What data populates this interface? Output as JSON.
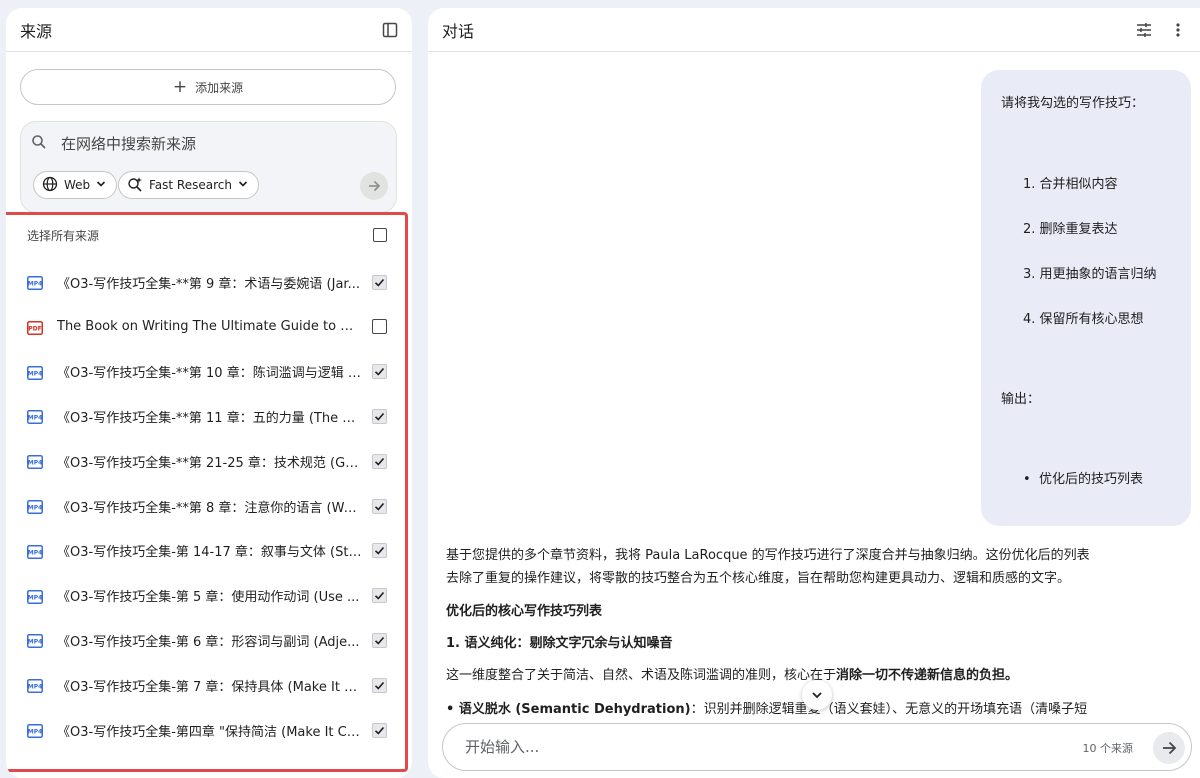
{
  "sources_panel": {
    "title": "来源",
    "add_source_label": "添加来源",
    "search_placeholder": "在网络中搜索新来源",
    "web_chip": "Web",
    "research_chip": "Fast Research",
    "select_all_label": "选择所有来源",
    "select_all_checked": false,
    "items": [
      {
        "type": "mp4",
        "label": "《O3-写作技巧全集-**第 9 章：术语与委婉语 (Jar...",
        "checked": true
      },
      {
        "type": "pdf",
        "label": "The Book on Writing The Ultimate Guide to Writin...",
        "checked": false
      },
      {
        "type": "mp4",
        "label": "《O3-写作技巧全集-**第 10 章：陈词滥调与逻辑 (...",
        "checked": true
      },
      {
        "type": "mp4",
        "label": "《O3-写作技巧全集-**第 11 章：五的力量 (The Po...",
        "checked": true
      },
      {
        "type": "mp4",
        "label": "《O3-写作技巧全集-**第 21-25 章：技术规范 (Gra...",
        "checked": true
      },
      {
        "type": "mp4",
        "label": "《O3-写作技巧全集-**第 8 章：注意你的语言 (Wa...",
        "checked": true
      },
      {
        "type": "mp4",
        "label": "《O3-写作技巧全集-第 14-17 章：叙事与文体 (Sto...",
        "checked": true
      },
      {
        "type": "mp4",
        "label": "《O3-写作技巧全集-第 5 章：使用动作动词 (Use ...",
        "checked": true
      },
      {
        "type": "mp4",
        "label": "《O3-写作技巧全集-第 6 章：形容词与副词 (Adje...",
        "checked": true
      },
      {
        "type": "mp4",
        "label": "《O3-写作技巧全集-第 7 章：保持具体 (Make It S...",
        "checked": true
      },
      {
        "type": "mp4",
        "label": "《O3-写作技巧全集-第四章 \"保持简洁 (Make It Co...",
        "checked": true
      }
    ]
  },
  "chat_panel": {
    "title": "对话",
    "user_message": {
      "intro": "请将我勾选的写作技巧：",
      "steps": [
        "1. 合并相似内容",
        "2. 删除重复表达",
        "3. 用更抽象的语言归纳",
        "4. 保留所有核心思想"
      ],
      "output_label": "输出：",
      "bullet": "优化后的技巧列表"
    },
    "answer": {
      "p1_line1": "基于您提供的多个章节资料，我将 Paula LaRocque 的写作技巧进行了深度合并与抽象归纳。这份优化后的列表",
      "p1_line2": "去除了重复的操作建议，将零散的技巧整合为五个核心维度，旨在帮助您构建更具动力、逻辑和质感的文字。",
      "heading": "优化后的核心写作技巧列表",
      "section1": "1. 语义纯化：剔除文字冗余与认知噪音",
      "p2_text": "这一维度整合了关于简洁、自然、术语及陈词滥调的准则，核心在于",
      "p2_bold": "消除一切不传递新信息的负担。",
      "bullet_bold": "• 语义脱水 (Semantic Dehydration)",
      "bullet_text": "：识别并删除逻辑重复（语义套娃）、无意义的开场填充语（清嗓子短"
    },
    "composer_placeholder": "开始输入...",
    "source_count": "10 个来源"
  }
}
